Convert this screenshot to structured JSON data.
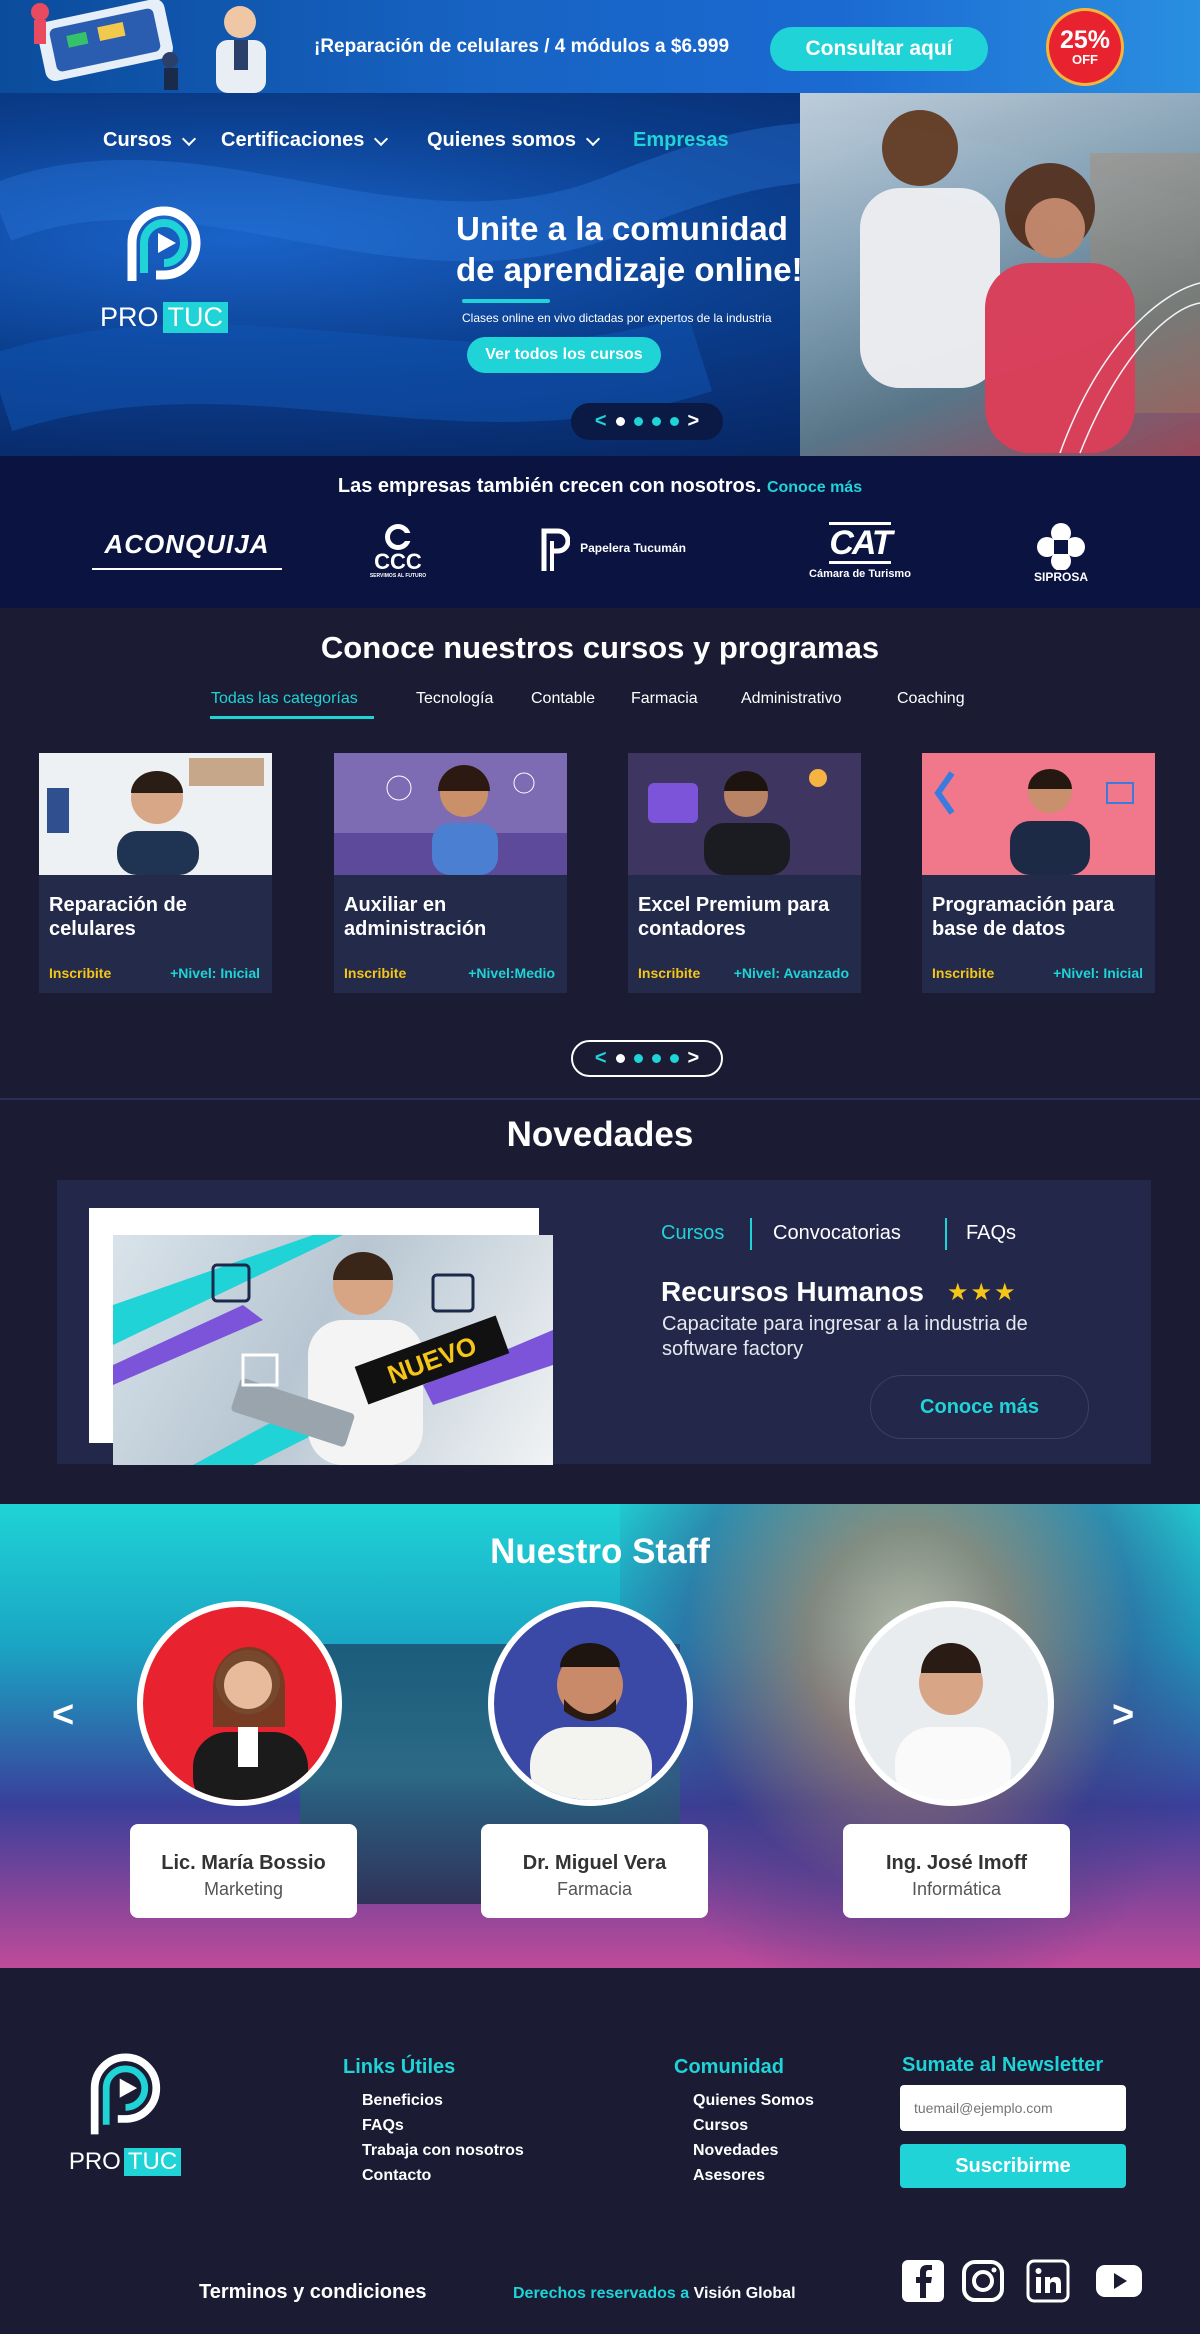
{
  "promo": {
    "text": "¡Reparación de celulares / 4 módulos a $6.999",
    "button": "Consultar aquí",
    "badge_percent": "25%",
    "badge_off": "OFF"
  },
  "nav": {
    "items": [
      {
        "label": "Cursos",
        "has_dropdown": true
      },
      {
        "label": "Certificaciones",
        "has_dropdown": true
      },
      {
        "label": "Quienes somos",
        "has_dropdown": true
      },
      {
        "label": "Empresas",
        "has_dropdown": false
      }
    ],
    "active_color": "#1fd3d6"
  },
  "logo": {
    "pro": "PRO",
    "tuc": "TUC"
  },
  "hero": {
    "title_line1": "Unite a la comunidad",
    "title_line2": "de aprendizaje online!",
    "subtitle": "Clases online en vivo dictadas por expertos de la industria",
    "button": "Ver todos los cursos",
    "slides": 4,
    "active_slide": 1
  },
  "companies": {
    "text": "Las empresas también crecen  con nosotros.",
    "link": "Conoce  más",
    "brands": [
      {
        "name": "ACONQUIJA"
      },
      {
        "name": "CCC",
        "tagline": "SERVIMOS AL FUTURO"
      },
      {
        "name": "Papelera Tucumán"
      },
      {
        "name": "CAT",
        "tagline": "Cámara de Turismo"
      },
      {
        "name": "SIPROSA"
      }
    ]
  },
  "courses": {
    "title": "Conoce nuestros cursos y programas",
    "categories": [
      "Todas las categorías",
      "Tecnología",
      "Contable",
      "Farmacia",
      "Administrativo",
      "Coaching"
    ],
    "active_category": "Todas las categorías",
    "cards": [
      {
        "title": "Reparación de celulares",
        "cta": "Inscribite",
        "level": "+Nivel: Inicial"
      },
      {
        "title": "Auxiliar  en administración",
        "cta": "Inscribite",
        "level": "+Nivel:Medio"
      },
      {
        "title": "Excel Premium para contadores",
        "cta": "Inscribite",
        "level": "+Nivel: Avanzado"
      },
      {
        "title": "Programación para base de datos",
        "cta": "Inscribite",
        "level": "+Nivel: Inicial"
      }
    ],
    "pager_slides": 4,
    "pager_active": 1
  },
  "news": {
    "title": "Novedades",
    "tabs": [
      "Cursos",
      "Convocatorias",
      "FAQs"
    ],
    "active_tab": "Cursos",
    "badge": "NUEVO",
    "course": "Recursos Humanos",
    "rating": 3,
    "stars": "★★★",
    "description": "Capacitate para ingresar a la industria de software factory",
    "button": "Conoce más"
  },
  "staff": {
    "title": "Nuestro Staff",
    "prev": "<",
    "next": ">",
    "members": [
      {
        "name": "Lic. María Bossio",
        "role": "Marketing"
      },
      {
        "name": "Dr. Miguel Vera",
        "role": "Farmacia"
      },
      {
        "name": "Ing. José Imoff",
        "role": "Informática"
      }
    ]
  },
  "footer": {
    "links_title": "Links Útiles",
    "links": [
      "Beneficios",
      "FAQs",
      "Trabaja con nosotros",
      "Contacto"
    ],
    "community_title": "Comunidad",
    "community": [
      "Quienes Somos",
      "Cursos",
      "Novedades",
      "Asesores"
    ],
    "newsletter_title": "Sumate al Newsletter",
    "newsletter_placeholder": "tuemail@ejemplo.com",
    "newsletter_button": "Suscribirme",
    "terms": "Terminos y condiciones",
    "rights_prefix": "Derechos reservados a",
    "rights_owner": "Visión Global",
    "social": [
      "facebook-icon",
      "instagram-icon",
      "linkedin-icon",
      "youtube-icon"
    ]
  },
  "colors": {
    "accent": "#1fd3d6",
    "gold": "#f5c518",
    "navy": "#1b1b33",
    "promo_red": "#e8232f"
  }
}
